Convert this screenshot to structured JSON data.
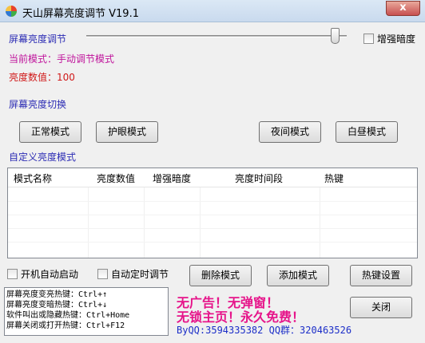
{
  "window": {
    "title": "天山屏幕亮度调节 V19.1",
    "close_label": "x"
  },
  "brightness": {
    "section_label": "屏幕亮度调节",
    "slider_value": 0.97,
    "enhance_dark_label": "增强暗度",
    "current_mode_label": "当前模式：手动调节模式",
    "value_label": "亮度数值：100"
  },
  "switch": {
    "section_label": "屏幕亮度切换",
    "buttons": [
      "正常模式",
      "护眼模式",
      "夜间模式",
      "白昼模式"
    ]
  },
  "custom": {
    "section_label": "自定义亮度模式",
    "columns": [
      "模式名称",
      "亮度数值",
      "增强暗度",
      "亮度时间段",
      "热键"
    ],
    "rows": []
  },
  "options": {
    "autostart_label": "开机自动启动",
    "auto_timer_label": "自动定时调节"
  },
  "actions": {
    "delete_label": "删除模式",
    "add_label": "添加模式",
    "hotkey_label": "热键设置",
    "close_label": "关闭"
  },
  "hotkeys": [
    "屏幕亮度变亮热键：Ctrl+↑",
    "屏幕亮度变暗热键：Ctrl+↓",
    "软件叫出或隐藏热键：Ctrl+Home",
    "屏幕关闭或打开热键：Ctrl+F12"
  ],
  "promo": {
    "line1": "无广告！无弹窗！",
    "line2": "无锁主页！永久免费！",
    "contact": "ByQQ:3594335382 QQ群：320463526"
  },
  "colors": {
    "section_blue": "#2c2cb4",
    "mode_magenta": "#c0149c",
    "value_red": "#d01818",
    "promo_pink": "#e6148a",
    "contact_blue": "#1c2ec8"
  }
}
